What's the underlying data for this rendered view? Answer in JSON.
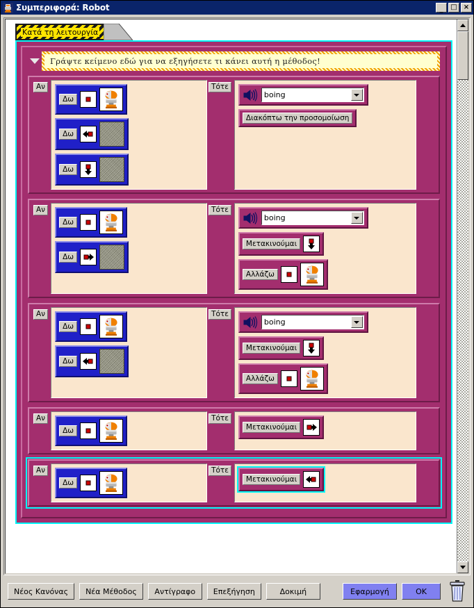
{
  "window": {
    "title": "Συμπεριφορά: Robot",
    "icon": "robot-icon",
    "minimize_label": "_",
    "maximize_label": "□",
    "close_label": "×"
  },
  "tab": {
    "label": "Κατά τη λειτουργία"
  },
  "comment": {
    "expander_icon": "triangle-down-icon",
    "text": "Γράψτε κείμενο εδώ για να εξηγήσετε τι κάνει αυτή η μέθοδος!"
  },
  "labels": {
    "if": "Αν",
    "then": "Τότε",
    "see": "Δω",
    "move": "Μετακινούμαι",
    "change": "Αλλάζω",
    "stop_sim": "Διακόπτω την προσομοίωση"
  },
  "colors": {
    "rule_purple": "#a32e6e",
    "condition_blue": "#2020c8",
    "slot_cream": "#fae6cd",
    "selection_cyan": "#00f7f7",
    "tab_yellow": "#ffe400",
    "accent_button": "#8080f0",
    "titlebar": "#0a246a"
  },
  "rules": [
    {
      "selected": false,
      "conditions": [
        {
          "tag": "Δω",
          "direction": "center",
          "object": "robot"
        },
        {
          "tag": "Δω",
          "direction": "left",
          "object": "stone"
        },
        {
          "tag": "Δω",
          "direction": "down",
          "object": "stone"
        }
      ],
      "actions": [
        {
          "type": "sound",
          "icon": "speaker-icon",
          "value": "boing",
          "dropdown_icon": "chevron-down-icon"
        },
        {
          "type": "command",
          "label": "Διακόπτω την προσομοίωση"
        }
      ]
    },
    {
      "selected": false,
      "conditions": [
        {
          "tag": "Δω",
          "direction": "center",
          "object": "robot"
        },
        {
          "tag": "Δω",
          "direction": "right",
          "object": "stone"
        }
      ],
      "actions": [
        {
          "type": "sound",
          "icon": "speaker-icon",
          "value": "boing",
          "dropdown_icon": "chevron-down-icon"
        },
        {
          "type": "move",
          "label": "Μετακινούμαι",
          "direction": "down"
        },
        {
          "type": "change",
          "label": "Αλλάζω",
          "direction": "center",
          "object": "robot"
        }
      ]
    },
    {
      "selected": false,
      "conditions": [
        {
          "tag": "Δω",
          "direction": "center",
          "object": "robot"
        },
        {
          "tag": "Δω",
          "direction": "left",
          "object": "stone"
        }
      ],
      "actions": [
        {
          "type": "sound",
          "icon": "speaker-icon",
          "value": "boing",
          "dropdown_icon": "chevron-down-icon"
        },
        {
          "type": "move",
          "label": "Μετακινούμαι",
          "direction": "down"
        },
        {
          "type": "change",
          "label": "Αλλάζω",
          "direction": "center",
          "object": "robot"
        }
      ]
    },
    {
      "selected": false,
      "conditions": [
        {
          "tag": "Δω",
          "direction": "center",
          "object": "robot"
        }
      ],
      "actions": [
        {
          "type": "move",
          "label": "Μετακινούμαι",
          "direction": "right"
        }
      ]
    },
    {
      "selected": true,
      "conditions": [
        {
          "tag": "Δω",
          "direction": "center",
          "object": "robot"
        }
      ],
      "actions": [
        {
          "type": "move",
          "label": "Μετακινούμαι",
          "direction": "left",
          "selected": true
        }
      ]
    }
  ],
  "scrollbar": {
    "up_icon": "scroll-up-icon",
    "down_icon": "scroll-down-icon"
  },
  "buttons": [
    {
      "label": "Νέος Κανόνας",
      "style": "normal",
      "name": "new-rule-button"
    },
    {
      "label": "Νέα Μέθοδος",
      "style": "normal",
      "name": "new-method-button"
    },
    {
      "label": "Αντίγραφο",
      "style": "normal",
      "name": "copy-button"
    },
    {
      "label": "Επεξήγηση",
      "style": "normal",
      "name": "explain-button"
    },
    {
      "label": "Δοκιμή",
      "style": "normal",
      "name": "test-button"
    },
    {
      "label": "Εφαρμογή",
      "style": "accent",
      "name": "apply-button"
    },
    {
      "label": "OK",
      "style": "ok",
      "name": "ok-button"
    }
  ],
  "trash": {
    "icon": "trash-icon"
  }
}
